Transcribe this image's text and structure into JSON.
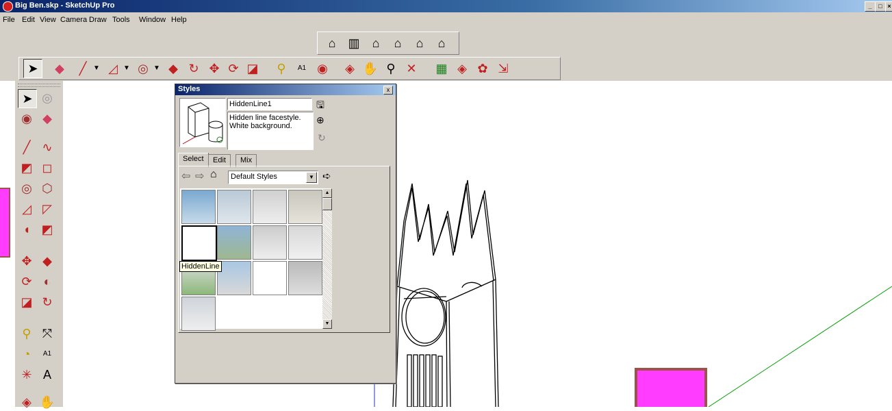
{
  "window": {
    "title": "Big Ben.skp - SketchUp Pro",
    "controls": [
      "_",
      "□",
      "×"
    ]
  },
  "menu": [
    "File",
    "Edit",
    "View",
    "Camera",
    "Draw",
    "Tools",
    "Window",
    "Help"
  ],
  "toolbars": {
    "views": [
      "iso-view-icon",
      "top-view-icon",
      "front-view-icon",
      "right-view-icon",
      "back-view-icon",
      "left-view-icon"
    ],
    "main": [
      "select-icon",
      "eraser-icon",
      "pencil-icon",
      "arc-icon",
      "circle-icon",
      "push-pull-icon",
      "follow-me-icon",
      "move-icon",
      "rotate-icon",
      "scale-icon",
      "tape-measure-icon",
      "text-icon",
      "paint-bucket-icon",
      "orbit-icon",
      "pan-icon",
      "zoom-icon",
      "zoom-extents-icon",
      "get-models-icon",
      "share-model-icon",
      "share-component-icon",
      "export-icon"
    ],
    "left": [
      "select-icon",
      "component-icon",
      "paint-bucket-icon",
      "eraser-icon",
      "pencil-icon",
      "freehand-icon",
      "rectangle-icon",
      "rotated-rectangle-icon",
      "circle-icon",
      "polygon-icon",
      "arc-icon",
      "2-point-arc-icon",
      "3-point-arc-icon",
      "pie-icon",
      "move-icon",
      "push-pull-icon",
      "rotate-icon",
      "follow-me-icon",
      "scale-icon",
      "offset-icon",
      "tape-measure-icon",
      "dimension-icon",
      "protractor-icon",
      "text-icon",
      "axes-icon",
      "3d-text-icon",
      "orbit-icon",
      "pan-icon"
    ]
  },
  "styles_panel": {
    "title": "Styles",
    "close": "x",
    "style_name": "HiddenLine1",
    "style_description": "Hidden line facestyle.\nWhite background.",
    "tabs": [
      "Select",
      "Edit",
      "Mix"
    ],
    "active_tab": "Select",
    "collection": "Default Styles",
    "tooltip": "HiddenLine",
    "thumbnails": 13
  },
  "colors": {
    "magenta": "#ff3cff",
    "magenta_border": "#a0504a",
    "axis_green": "#00a000",
    "axis_blue": "#2030c0"
  }
}
